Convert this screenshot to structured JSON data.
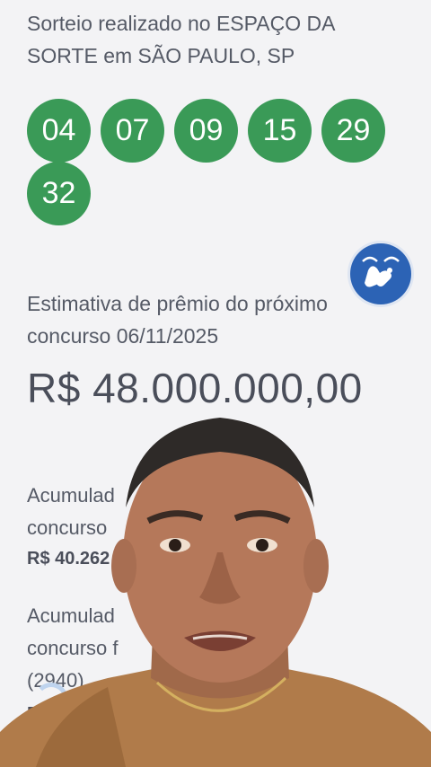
{
  "result": {
    "draw_location": "Sorteio realizado no ESPAÇO DA SORTE em SÃO PAULO, SP",
    "numbers": [
      "04",
      "07",
      "09",
      "15",
      "29",
      "32"
    ]
  },
  "accessibility": {
    "icon": "sign-language-icon"
  },
  "next_contest": {
    "estimate_label": "Estimativa de prêmio do próximo concurso 06/11/2025",
    "estimate_value": "R$ 48.000.000,00"
  },
  "accumulated": [
    {
      "label_line1": "Acumulad",
      "label_line2": "concurso",
      "value": "R$ 40.262"
    },
    {
      "label_line1": "Acumulad",
      "label_line2": "concurso f",
      "label_line3": "(2940)",
      "value": "R"
    }
  ],
  "colors": {
    "ball_green": "#3a9a57",
    "accessibility_blue": "#2c63b5",
    "background": "#f3f3f5"
  }
}
